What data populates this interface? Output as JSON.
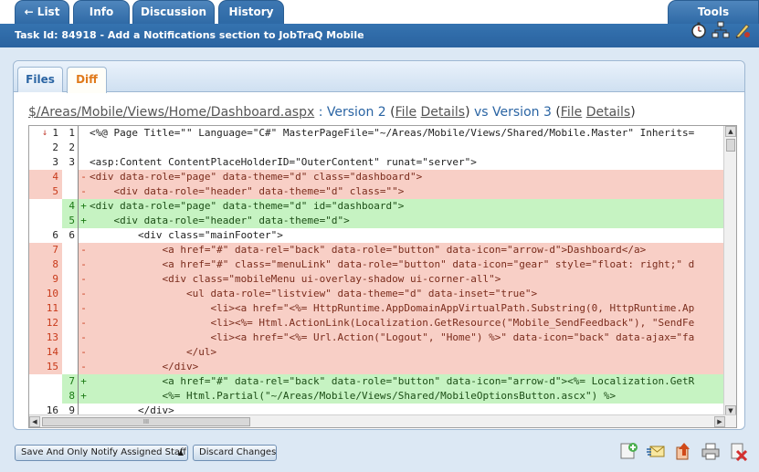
{
  "nav": {
    "tabs": [
      {
        "label": "← List"
      },
      {
        "label": "Info"
      },
      {
        "label": "Discussion"
      },
      {
        "label": "History"
      }
    ],
    "tools_label": "Tools"
  },
  "title": "Task Id: 84918 - Add a Notifications section to JobTraQ Mobile",
  "subtabs": [
    {
      "label": "Files"
    },
    {
      "label": "Diff"
    }
  ],
  "diff_header": {
    "path": "$/Areas/Mobile/Views/Home/Dashboard.aspx",
    "sep": " : ",
    "v2": "Version 2",
    "v2_open": " (",
    "v2_file": "File",
    "v2_details": "Details",
    "v2_close": ")",
    "vs": " vs ",
    "v3": "Version 3",
    "v3_open": " (",
    "v3_file": "File",
    "v3_details": "Details",
    "v3_close": ")"
  },
  "diff_lines": [
    {
      "type": "ctx",
      "old": "1",
      "new": "1",
      "marker": "",
      "text": "<%@ Page Title=\"\" Language=\"C#\" MasterPageFile=\"~/Areas/Mobile/Views/Shared/Mobile.Master\" Inherits="
    },
    {
      "type": "ctx",
      "old": "2",
      "new": "2",
      "marker": "",
      "text": ""
    },
    {
      "type": "ctx",
      "old": "3",
      "new": "3",
      "marker": "",
      "text": "<asp:Content ContentPlaceHolderID=\"OuterContent\" runat=\"server\">"
    },
    {
      "type": "del",
      "old": "4",
      "new": "",
      "marker": "-",
      "text": "<div data-role=\"page\" data-theme=\"d\" class=\"dashboard\">"
    },
    {
      "type": "del",
      "old": "5",
      "new": "",
      "marker": "-",
      "text": "    <div data-role=\"header\" data-theme=\"d\" class=\"\">"
    },
    {
      "type": "add",
      "old": "",
      "new": "4",
      "marker": "+",
      "text": "<div data-role=\"page\" data-theme=\"d\" id=\"dashboard\">"
    },
    {
      "type": "add",
      "old": "",
      "new": "5",
      "marker": "+",
      "text": "    <div data-role=\"header\" data-theme=\"d\">"
    },
    {
      "type": "ctx",
      "old": "6",
      "new": "6",
      "marker": "",
      "text": "        <div class=\"mainFooter\">"
    },
    {
      "type": "del",
      "old": "7",
      "new": "",
      "marker": "-",
      "text": "            <a href=\"#\" data-rel=\"back\" data-role=\"button\" data-icon=\"arrow-d\">Dashboard</a>"
    },
    {
      "type": "del",
      "old": "8",
      "new": "",
      "marker": "-",
      "text": "            <a href=\"#\" class=\"menuLink\" data-role=\"button\" data-icon=\"gear\" style=\"float: right;\" d"
    },
    {
      "type": "del",
      "old": "9",
      "new": "",
      "marker": "-",
      "text": "            <div class=\"mobileMenu ui-overlay-shadow ui-corner-all\">"
    },
    {
      "type": "del",
      "old": "10",
      "new": "",
      "marker": "-",
      "text": "                <ul data-role=\"listview\" data-theme=\"d\" data-inset=\"true\">"
    },
    {
      "type": "del",
      "old": "11",
      "new": "",
      "marker": "-",
      "text": "                    <li><a href=\"<%= HttpRuntime.AppDomainAppVirtualPath.Substring(0, HttpRuntime.Ap"
    },
    {
      "type": "del",
      "old": "12",
      "new": "",
      "marker": "-",
      "text": "                    <li><%= Html.ActionLink(Localization.GetResource(\"Mobile_SendFeedback\"), \"SendFe"
    },
    {
      "type": "del",
      "old": "13",
      "new": "",
      "marker": "-",
      "text": "                    <li><a href=\"<%= Url.Action(\"Logout\", \"Home\") %>\" data-icon=\"back\" data-ajax=\"fa"
    },
    {
      "type": "del",
      "old": "14",
      "new": "",
      "marker": "-",
      "text": "                </ul>"
    },
    {
      "type": "del",
      "old": "15",
      "new": "",
      "marker": "-",
      "text": "            </div>"
    },
    {
      "type": "add",
      "old": "",
      "new": "7",
      "marker": "+",
      "text": "            <a href=\"#\" data-rel=\"back\" data-role=\"button\" data-icon=\"arrow-d\"><%= Localization.GetR"
    },
    {
      "type": "add",
      "old": "",
      "new": "8",
      "marker": "+",
      "text": "            <%= Html.Partial(\"~/Areas/Mobile/Views/Shared/MobileOptionsButton.ascx\") %>"
    },
    {
      "type": "ctx",
      "old": "16",
      "new": "9",
      "marker": "",
      "text": "        </div>"
    }
  ],
  "scroll_thumb_glyph": "III",
  "bottom": {
    "primary_button": "Save And Only Notify Assigned Staff",
    "secondary_button": "Discard Changes"
  }
}
